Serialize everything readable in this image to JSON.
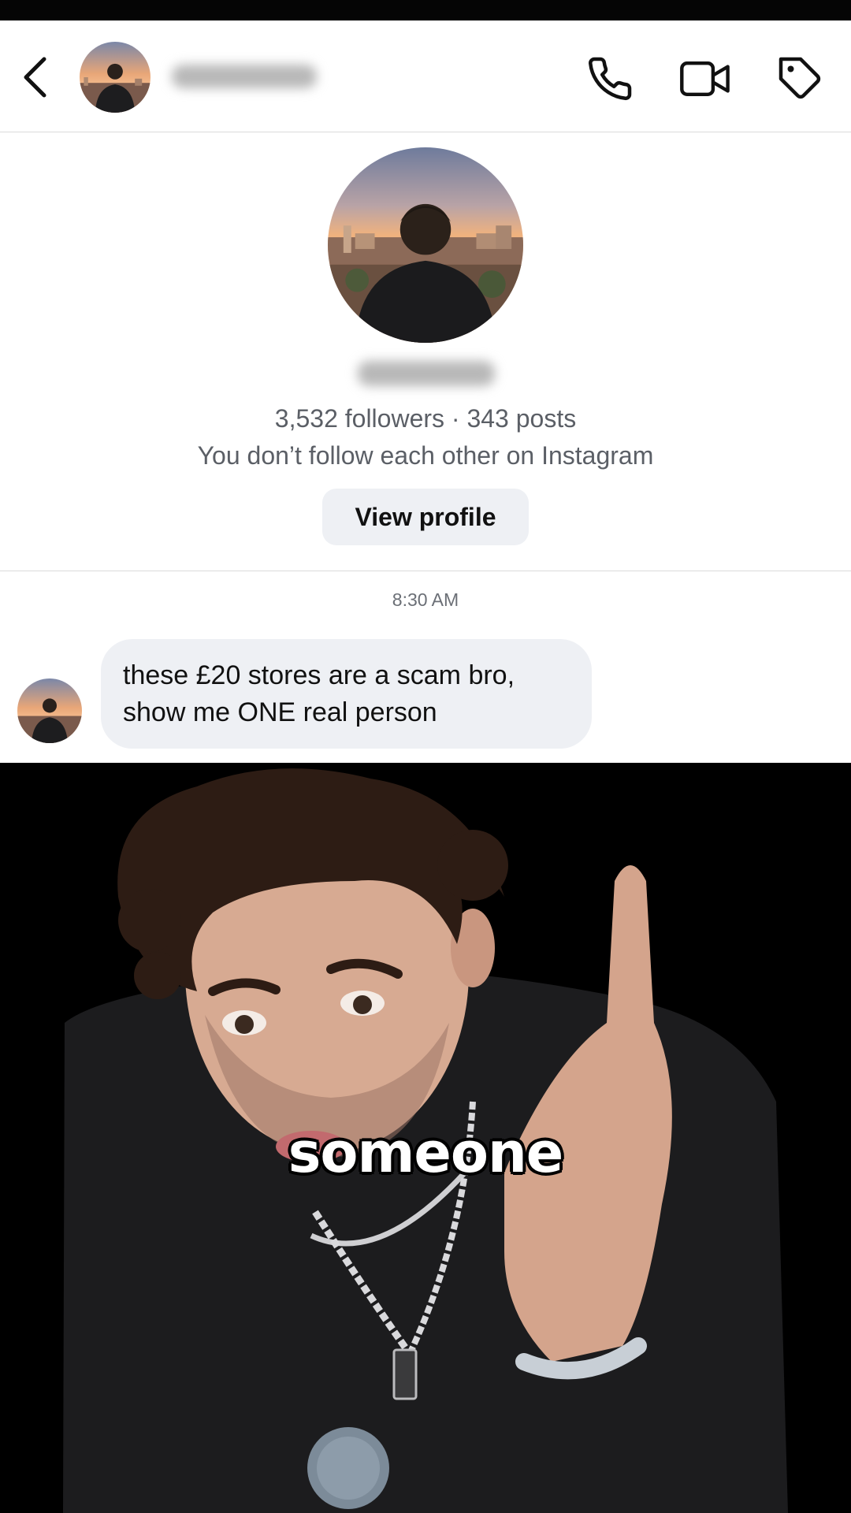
{
  "header": {
    "back_icon": "chevron-left-icon",
    "call_icon": "phone-icon",
    "video_icon": "video-camera-icon",
    "tag_icon": "tag-icon"
  },
  "profile": {
    "stats": "3,532 followers · 343 posts",
    "follow_status": "You don’t follow each other on Instagram",
    "view_profile_label": "View profile"
  },
  "conversation": {
    "timestamp": "8:30 AM",
    "messages": [
      {
        "lines": [
          "these £20 stores are a scam bro,",
          "show me ONE real person"
        ]
      }
    ]
  },
  "video": {
    "caption": "someone"
  },
  "colors": {
    "bubble_bg": "#eef0f4",
    "secondary_text": "#5b5f66",
    "divider": "#dbdbdb"
  }
}
